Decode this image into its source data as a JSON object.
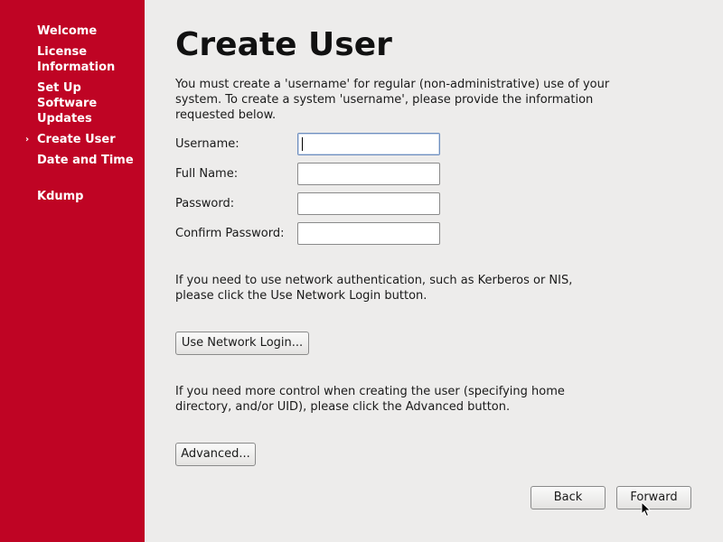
{
  "sidebar": {
    "items": [
      {
        "label": "Welcome"
      },
      {
        "label": "License Information"
      },
      {
        "label": "Set Up Software Updates"
      },
      {
        "label": "Create User",
        "active": true
      },
      {
        "label": "Date and Time"
      },
      {
        "label": "Kdump"
      }
    ],
    "active_marker": "›"
  },
  "main": {
    "title": "Create User",
    "intro": "You must create a 'username' for regular (non-administrative) use of your system.  To create a system 'username', please provide the information requested below.",
    "fields": {
      "username": {
        "label": "Username:",
        "value": ""
      },
      "fullname": {
        "label": "Full Name:",
        "value": ""
      },
      "password": {
        "label": "Password:",
        "value": ""
      },
      "confirm": {
        "label": "Confirm Password:",
        "value": ""
      }
    },
    "network_text": "If you need to use network authentication, such as Kerberos or NIS, please click the Use Network Login button.",
    "network_button": "Use Network Login...",
    "advanced_text": "If you need more control when creating the user (specifying home directory, and/or UID), please click the Advanced button.",
    "advanced_button": "Advanced..."
  },
  "footer": {
    "back": "Back",
    "forward": "Forward"
  },
  "colors": {
    "sidebar_bg": "#bf0424",
    "content_bg": "#edeceb"
  }
}
